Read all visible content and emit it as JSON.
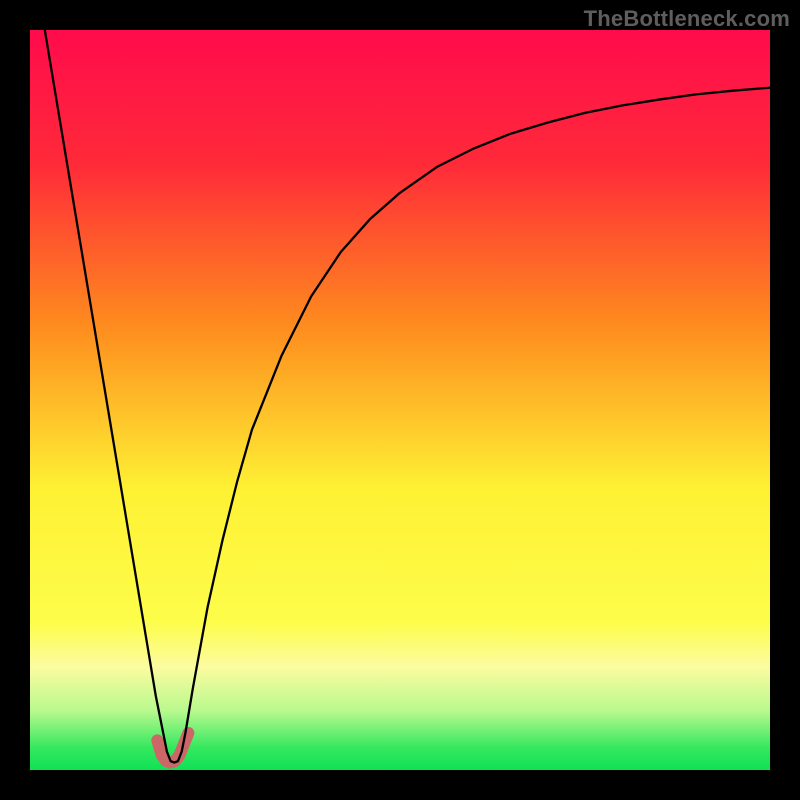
{
  "watermark": "TheBottleneck.com",
  "chart_data": {
    "type": "line",
    "title": "",
    "xlabel": "",
    "ylabel": "",
    "xlim": [
      0,
      100
    ],
    "ylim": [
      0,
      100
    ],
    "grid": false,
    "series": [
      {
        "name": "bottleneck-curve",
        "x": [
          2,
          4,
          6,
          8,
          10,
          12,
          14,
          16,
          17,
          18,
          18.5,
          19,
          19.5,
          20,
          20.5,
          21,
          22,
          24,
          26,
          28,
          30,
          34,
          38,
          42,
          46,
          50,
          55,
          60,
          65,
          70,
          75,
          80,
          85,
          90,
          95,
          100
        ],
        "y": [
          100,
          88,
          76,
          64,
          52,
          40,
          28,
          16,
          10,
          5,
          2.5,
          1.2,
          1.0,
          1.2,
          2.5,
          5,
          11,
          22,
          31,
          39,
          46,
          56,
          64,
          70,
          74.5,
          78,
          81.5,
          84,
          86,
          87.5,
          88.8,
          89.8,
          90.6,
          91.3,
          91.8,
          92.2
        ]
      },
      {
        "name": "highlight-valley",
        "x": [
          17.2,
          17.8,
          18.4,
          19.0,
          19.6,
          20.2,
          20.8,
          21.4
        ],
        "y": [
          4.0,
          2.0,
          1.2,
          1.0,
          1.2,
          2.0,
          3.5,
          5.0
        ]
      }
    ],
    "background_gradient": {
      "stops": [
        {
          "offset": 0.0,
          "color": "#ff0b4c"
        },
        {
          "offset": 0.18,
          "color": "#ff2a39"
        },
        {
          "offset": 0.4,
          "color": "#fe8c1e"
        },
        {
          "offset": 0.62,
          "color": "#fef134"
        },
        {
          "offset": 0.8,
          "color": "#fdfd4a"
        },
        {
          "offset": 0.86,
          "color": "#fcfca0"
        },
        {
          "offset": 0.92,
          "color": "#b9f98e"
        },
        {
          "offset": 0.97,
          "color": "#35e85f"
        },
        {
          "offset": 1.0,
          "color": "#0fe156"
        }
      ]
    },
    "styles": {
      "bottleneck-curve": {
        "stroke": "#000000",
        "stroke_width": 2.3
      },
      "highlight-valley": {
        "stroke": "#cc6667",
        "stroke_width": 12,
        "linecap": "round"
      }
    }
  }
}
